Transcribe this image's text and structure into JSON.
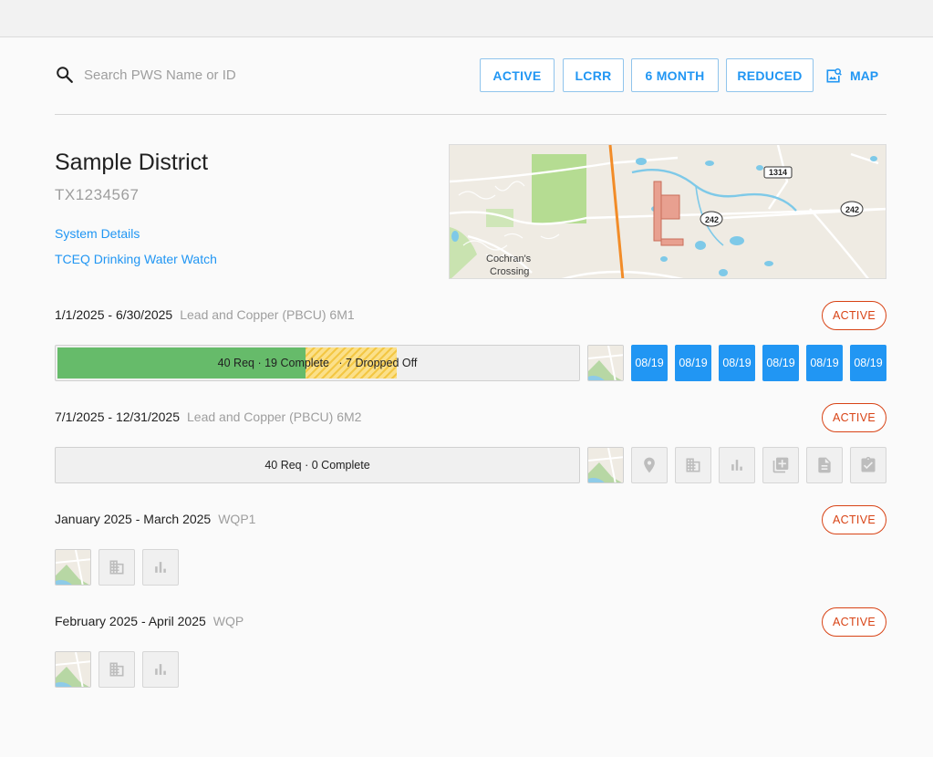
{
  "search": {
    "placeholder": "Search PWS Name or ID",
    "value": ""
  },
  "filters": [
    {
      "label": "ACTIVE"
    },
    {
      "label": "LCRR"
    },
    {
      "label": "6 MONTH"
    },
    {
      "label": "REDUCED"
    }
  ],
  "map_button": {
    "label": "MAP"
  },
  "district": {
    "name": "Sample District",
    "id": "TX1234567",
    "links": [
      "System Details",
      "TCEQ Drinking Water Watch"
    ]
  },
  "map": {
    "labels": {
      "place": "Cochran's",
      "place2": "Crossing",
      "road1": "1314",
      "road2": "242",
      "road3": "242"
    }
  },
  "periods": [
    {
      "dates": "1/1/2025 - 6/30/2025",
      "program": "Lead and Copper (PBCU) 6M1",
      "status": "ACTIVE",
      "progress_text": "40 Req · 19 Complete   · 7 Dropped Off",
      "required": 40,
      "complete": 19,
      "dropped_off": 7,
      "dates_buttons": [
        "08/19",
        "08/19",
        "08/19",
        "08/19",
        "08/19",
        "08/19"
      ]
    },
    {
      "dates": "7/1/2025 - 12/31/2025",
      "program": "Lead and Copper (PBCU) 6M2",
      "status": "ACTIVE",
      "progress_text": "40 Req · 0 Complete",
      "required": 40,
      "complete": 0,
      "dropped_off": 0,
      "icons": [
        "location-pin-icon",
        "building-icon",
        "bar-chart-icon",
        "copy-icon",
        "document-icon",
        "clipboard-check-icon"
      ]
    },
    {
      "dates": "January 2025 - March 2025",
      "program": "WQP1",
      "status": "ACTIVE",
      "icons": [
        "building-icon",
        "bar-chart-icon"
      ]
    },
    {
      "dates": "February 2025 - April 2025",
      "program": "WQP",
      "status": "ACTIVE",
      "icons": [
        "building-icon",
        "bar-chart-icon"
      ]
    }
  ],
  "colors": {
    "accent": "#2196f3",
    "active": "#d84315",
    "complete": "#66bb6a",
    "dropped": "#f3c744"
  }
}
